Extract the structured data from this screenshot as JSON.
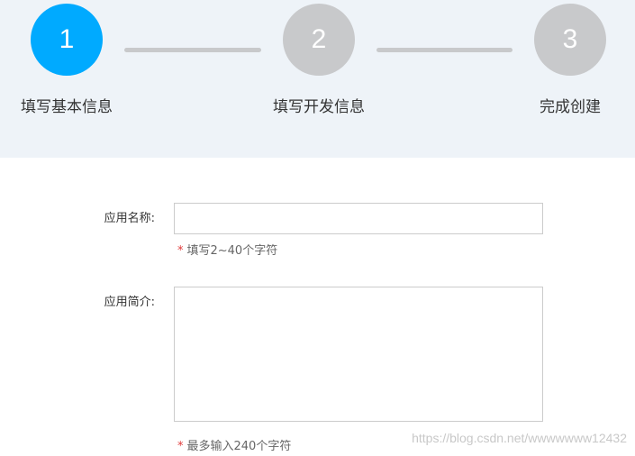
{
  "colors": {
    "active_step": "#00aaff",
    "inactive_step": "#c8c9cb",
    "stepper_background": "#eef3f8",
    "required_mark": "#e03a3a"
  },
  "steps": [
    {
      "number": "1",
      "label": "填写基本信息",
      "state": "active"
    },
    {
      "number": "2",
      "label": "填写开发信息",
      "state": "inactive"
    },
    {
      "number": "3",
      "label": "完成创建",
      "state": "inactive"
    }
  ],
  "form": {
    "app_name": {
      "label": "应用名称:",
      "value": "",
      "required_mark": "*",
      "hint": "填写2~40个字符"
    },
    "app_intro": {
      "label": "应用简介:",
      "value": "",
      "required_mark": "*",
      "hint": "最多输入240个字符"
    }
  },
  "watermark": "https://blog.csdn.net/wwwwwww12432"
}
